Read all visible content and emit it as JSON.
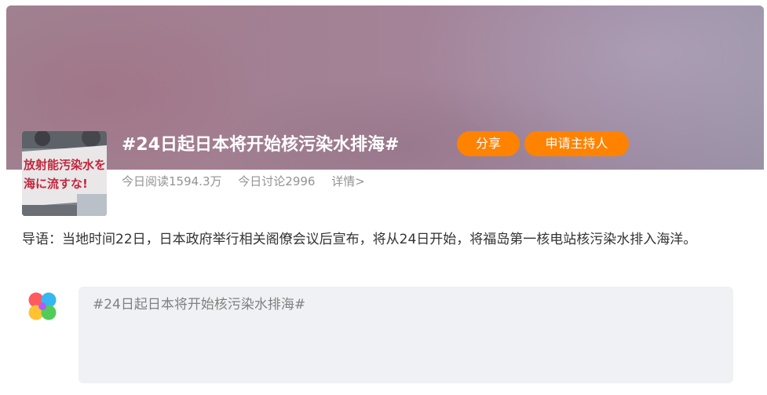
{
  "topic": {
    "title": "#24日起日本将开始核污染水排海#",
    "share_label": "分享",
    "host_label": "申请主持人",
    "reads": "今日阅读1594.3万",
    "discussions": "今日讨论2996",
    "details_link": "详情>",
    "thumbnail_text": [
      "放射能汚染水を",
      "海に流すな!"
    ]
  },
  "lead": {
    "text": "导语：当地时间22日，日本政府举行相关阁僚会议后宣布，将从24日开始，将福岛第一核电站核污染水排入海洋。"
  },
  "composer": {
    "placeholder": "#24日起日本将开始核污染水排海#"
  },
  "colors": {
    "accent": "#ff8200",
    "muted_text": "#939393",
    "composer_bg": "#f0f1f4"
  },
  "icons": {
    "app_logo": "four-petal-app-logo-icon"
  }
}
